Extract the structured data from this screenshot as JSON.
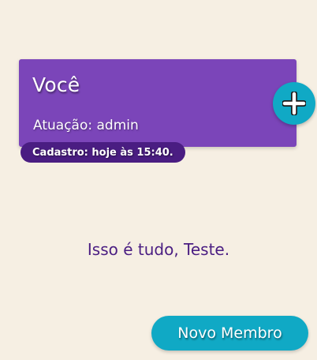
{
  "colors": {
    "background": "#f6efe3",
    "card": "#7b45b9",
    "badge": "#4a1d82",
    "accent": "#10a9c5",
    "message_text": "#4a1d82"
  },
  "member_card": {
    "name": "Você",
    "role": "Atuação: admin",
    "signup": "Cadastro: hoje às 15:40.",
    "action_icon": "plus-icon"
  },
  "message": "Isso é tudo, Teste.",
  "new_member_button": {
    "label": "Novo Membro"
  }
}
